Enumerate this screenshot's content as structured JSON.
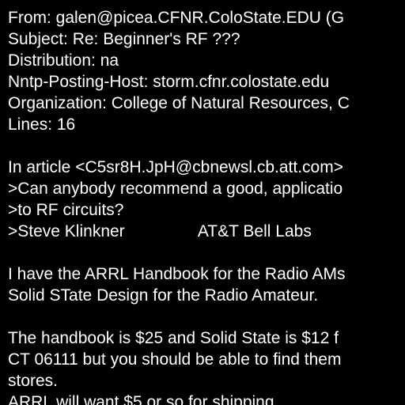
{
  "colors": {
    "background": "#000000",
    "text": "#ffffff"
  },
  "message": {
    "header": {
      "from": "From: galen@picea.CFNR.ColoState.EDU (G",
      "subject": "Subject: Re: Beginner's RF ???",
      "distribution": "Distribution: na",
      "posting_host": "Nntp-Posting-Host: storm.cfnr.colostate.edu",
      "organization": "Organization: College of Natural Resources, C",
      "lines": "Lines: 16"
    },
    "body": {
      "intro": "In article <C5sr8H.JpH@cbnewsl.cb.att.com>",
      "quote_1": ">Can anybody recommend a good, applicatio",
      "quote_2": ">to RF circuits?",
      "quote_3": ">Steve Klinkner                AT&T Bell Labs",
      "para1_line1": "I have the ARRL Handbook for the Radio AMs",
      "para1_line2": "Solid STate Design for the Radio Amateur.",
      "para2_line1": "The handbook is $25 and Solid State is $12 f",
      "para2_line2": "CT 06111 but you should be able to find them",
      "para2_line3": "stores.",
      "para3_line1": "ARRL will want $5 or so for shipping."
    }
  }
}
